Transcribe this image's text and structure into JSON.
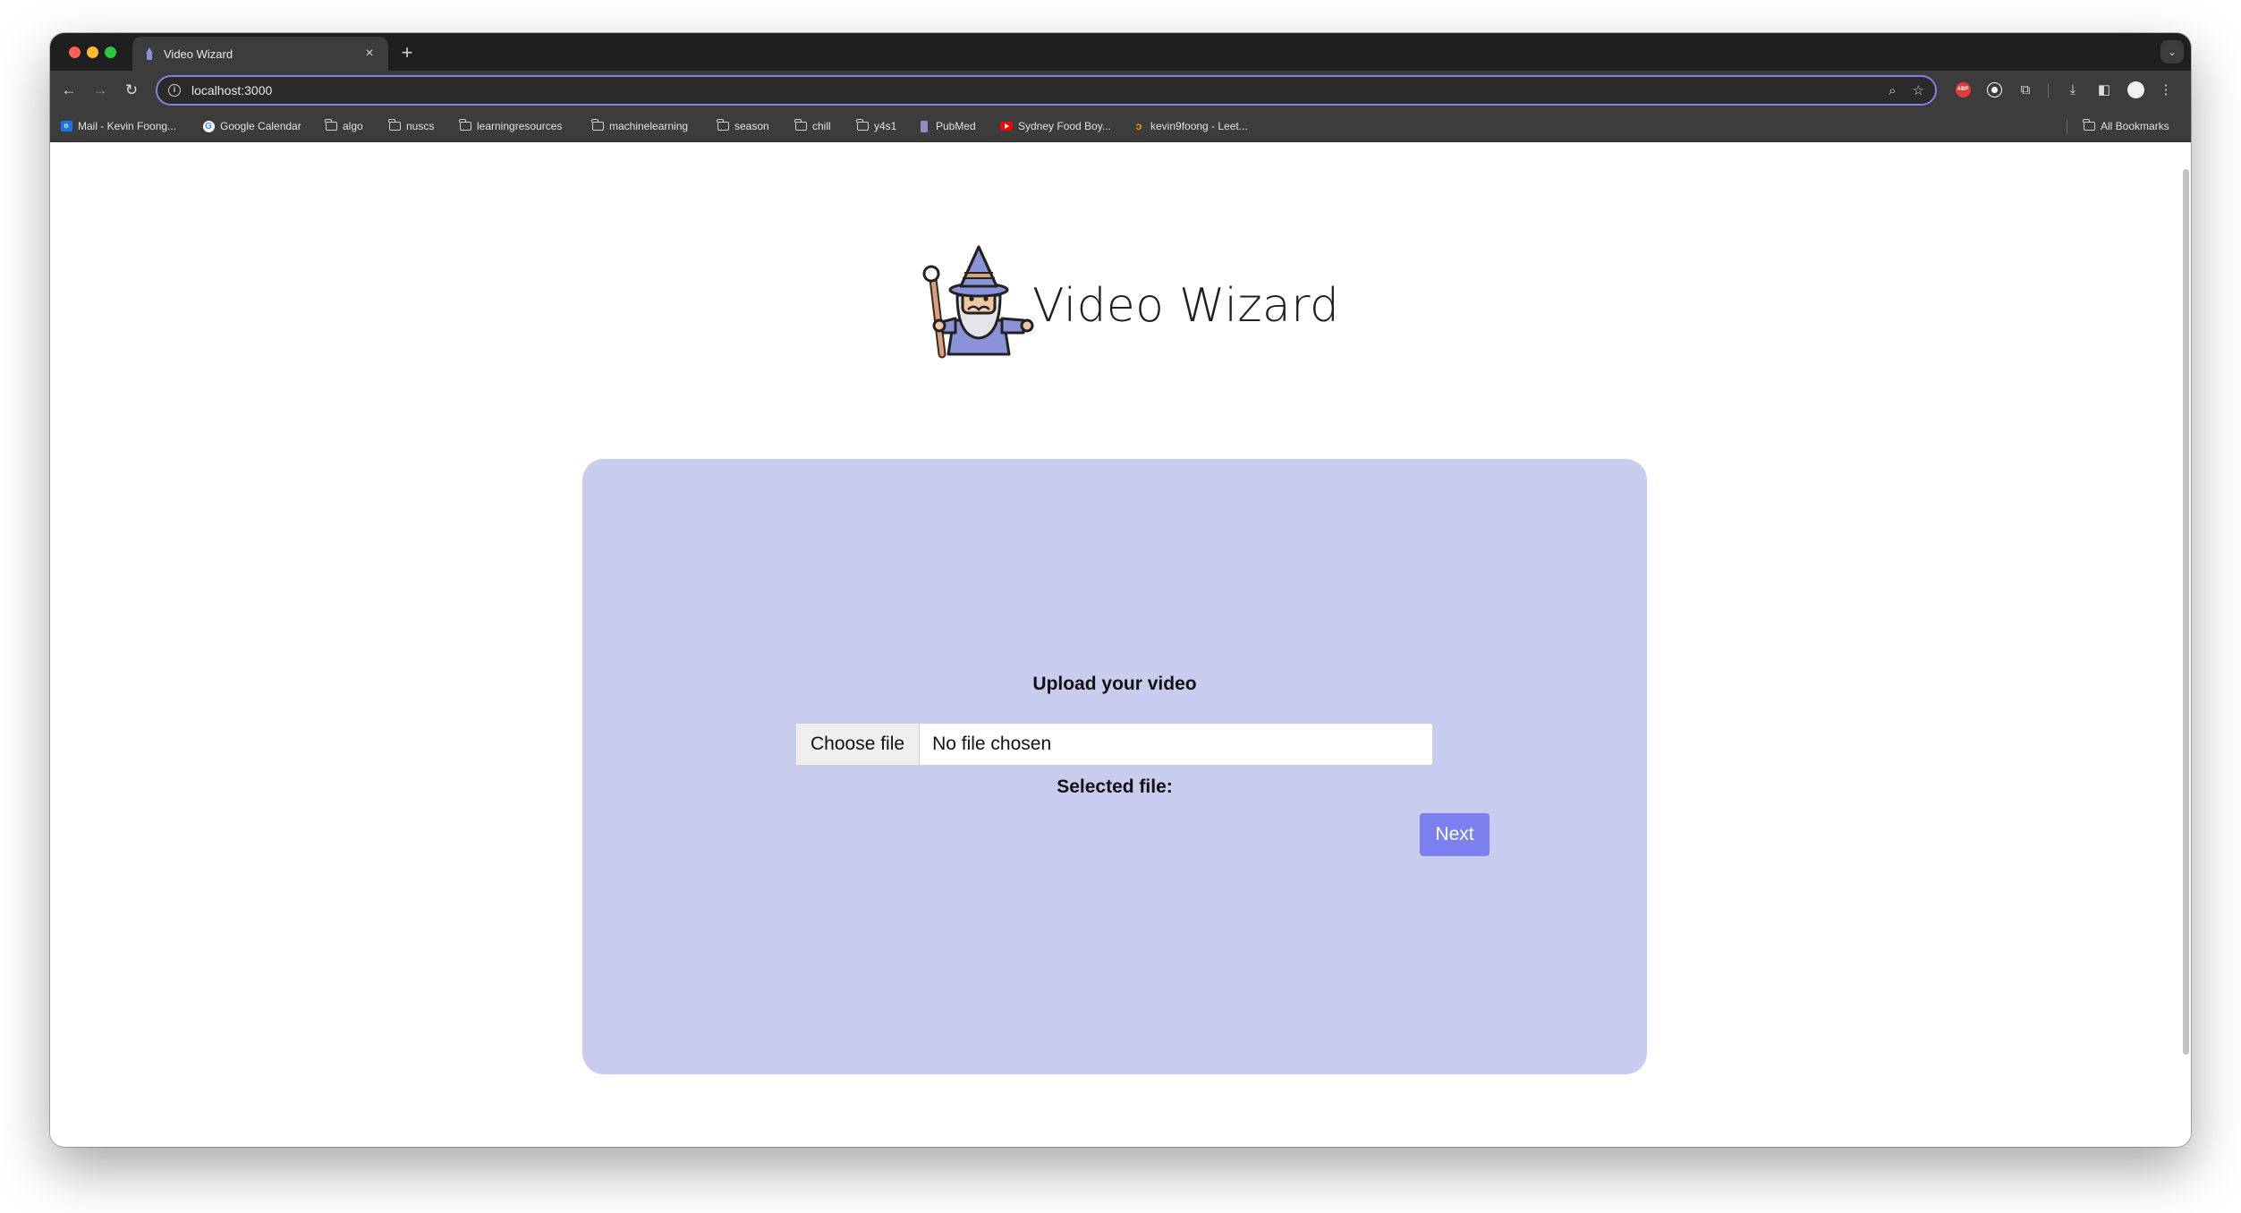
{
  "browser": {
    "tab": {
      "title": "Video Wizard",
      "close_glyph": "×"
    },
    "new_tab_glyph": "+",
    "tab_search_glyph": "⌄",
    "nav": {
      "back": "←",
      "forward": "→",
      "reload": "↻"
    },
    "omnibox": {
      "url": "localhost:3000",
      "zoom_icon": "⌕",
      "star_icon": "☆"
    },
    "extensions": {
      "abp_label": "ABP"
    },
    "toolbar": {
      "download_icon": "⤓",
      "sidepanel_icon": "◧",
      "menu_icon": "⋮",
      "puzzle_icon": "⧉"
    },
    "bookmarks": [
      {
        "label": "Mail - Kevin Foong...",
        "icon": "mail"
      },
      {
        "label": "Google Calendar",
        "icon": "google"
      },
      {
        "label": "algo",
        "icon": "folder"
      },
      {
        "label": "nuscs",
        "icon": "folder"
      },
      {
        "label": "learningresources",
        "icon": "folder"
      },
      {
        "label": "machinelearning",
        "icon": "folder"
      },
      {
        "label": "season",
        "icon": "folder"
      },
      {
        "label": "chill",
        "icon": "folder"
      },
      {
        "label": "y4s1",
        "icon": "folder"
      },
      {
        "label": "PubMed",
        "icon": "pubmed"
      },
      {
        "label": "Sydney Food Boy...",
        "icon": "youtube"
      },
      {
        "label": "kevin9foong - Leet...",
        "icon": "leetcode"
      }
    ],
    "all_bookmarks": "All Bookmarks"
  },
  "page": {
    "title": "Video Wizard",
    "upload": {
      "heading": "Upload your video",
      "choose_button": "Choose file",
      "file_status": "No file chosen",
      "selected_label": "Selected file:",
      "next_button": "Next"
    }
  },
  "colors": {
    "card_bg": "#c8ccee",
    "next_button_bg": "#7b7ff0",
    "omnibox_focus": "#7b86e0"
  }
}
